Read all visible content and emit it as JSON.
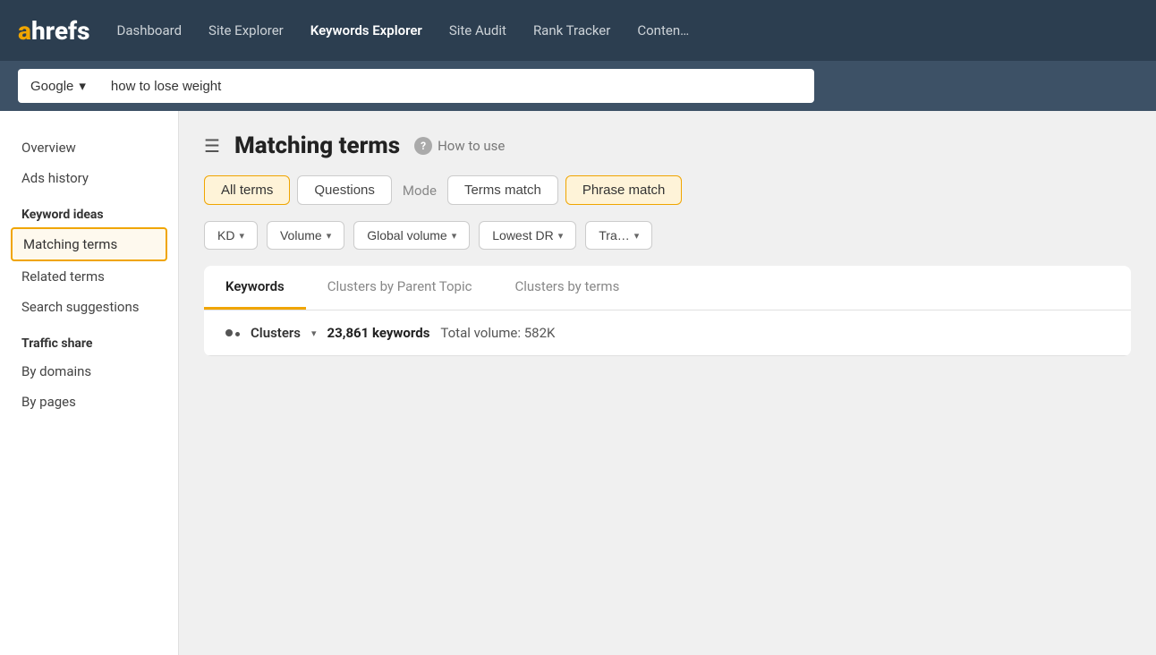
{
  "nav": {
    "logo": "ahrefs",
    "logo_a": "a",
    "logo_rest": "hrefs",
    "links": [
      {
        "label": "Dashboard",
        "active": false
      },
      {
        "label": "Site Explorer",
        "active": false
      },
      {
        "label": "Keywords Explorer",
        "active": true
      },
      {
        "label": "Site Audit",
        "active": false
      },
      {
        "label": "Rank Tracker",
        "active": false
      },
      {
        "label": "Conten…",
        "active": false
      }
    ]
  },
  "search": {
    "engine": "Google",
    "query": "how to lose weight",
    "engine_dropdown_icon": "▾"
  },
  "sidebar": {
    "items": [
      {
        "label": "Overview",
        "type": "item",
        "active": false
      },
      {
        "label": "Ads history",
        "type": "item",
        "active": false
      },
      {
        "label": "Keyword ideas",
        "type": "section"
      },
      {
        "label": "Matching terms",
        "type": "item",
        "active": true
      },
      {
        "label": "Related terms",
        "type": "item",
        "active": false
      },
      {
        "label": "Search suggestions",
        "type": "item",
        "active": false
      },
      {
        "label": "Traffic share",
        "type": "section"
      },
      {
        "label": "By domains",
        "type": "item",
        "active": false
      },
      {
        "label": "By pages",
        "type": "item",
        "active": false
      }
    ]
  },
  "main": {
    "page_title": "Matching terms",
    "how_to_use": "How to use",
    "tabs": [
      {
        "label": "All terms",
        "active": true
      },
      {
        "label": "Questions",
        "active": false
      }
    ],
    "mode_label": "Mode",
    "mode_tabs": [
      {
        "label": "Terms match",
        "active": false
      },
      {
        "label": "Phrase match",
        "active": true
      }
    ],
    "filters": [
      {
        "label": "KD"
      },
      {
        "label": "Volume"
      },
      {
        "label": "Global volume"
      },
      {
        "label": "Lowest DR"
      },
      {
        "label": "Tra…"
      }
    ],
    "table": {
      "tabs": [
        {
          "label": "Keywords",
          "active": true
        },
        {
          "label": "Clusters by Parent Topic",
          "active": false
        },
        {
          "label": "Clusters by terms",
          "active": false
        }
      ],
      "clusters_label": "Clusters",
      "keywords_count": "23,861 keywords",
      "total_volume": "Total volume: 582K"
    }
  },
  "colors": {
    "orange": "#f0a500",
    "nav_bg": "#2c3e50",
    "search_bg": "#3d5166"
  }
}
